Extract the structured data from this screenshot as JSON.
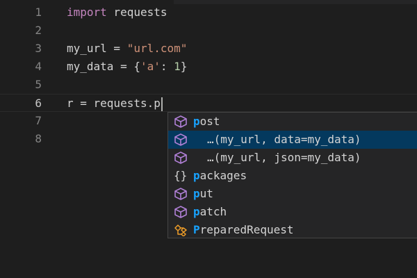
{
  "editor": {
    "lines": [
      {
        "number": "1",
        "tokens": [
          {
            "t": "import",
            "c": "kw"
          },
          {
            "t": " requests",
            "c": "txt"
          }
        ]
      },
      {
        "number": "2",
        "tokens": []
      },
      {
        "number": "3",
        "tokens": [
          {
            "t": "my_url",
            "c": "txt"
          },
          {
            "t": " = ",
            "c": "txt"
          },
          {
            "t": "\"url.com\"",
            "c": "str"
          }
        ]
      },
      {
        "number": "4",
        "tokens": [
          {
            "t": "my_data",
            "c": "txt"
          },
          {
            "t": " = {",
            "c": "txt"
          },
          {
            "t": "'a'",
            "c": "str"
          },
          {
            "t": ": ",
            "c": "txt"
          },
          {
            "t": "1",
            "c": "num"
          },
          {
            "t": "}",
            "c": "txt"
          }
        ]
      },
      {
        "number": "5",
        "tokens": []
      },
      {
        "number": "6",
        "tokens": [
          {
            "t": "r = requests.p",
            "c": "txt"
          }
        ],
        "current": true
      },
      {
        "number": "7",
        "tokens": []
      },
      {
        "number": "8",
        "tokens": []
      }
    ]
  },
  "suggestions": [
    {
      "icon": "cube-icon",
      "match": "p",
      "rest": "ost",
      "indent": false,
      "selected": false
    },
    {
      "icon": "cube-icon",
      "match": "",
      "rest": "…(my_url, data=my_data)",
      "indent": true,
      "selected": true
    },
    {
      "icon": "cube-icon",
      "match": "",
      "rest": "…(my_url, json=my_data)",
      "indent": true,
      "selected": false
    },
    {
      "icon": "braces-icon",
      "match": "p",
      "rest": "ackages",
      "indent": false,
      "selected": false
    },
    {
      "icon": "cube-icon",
      "match": "p",
      "rest": "ut",
      "indent": false,
      "selected": false
    },
    {
      "icon": "cube-icon",
      "match": "p",
      "rest": "atch",
      "indent": false,
      "selected": false
    },
    {
      "icon": "class-icon",
      "match": "P",
      "rest": "reparedRequest",
      "indent": false,
      "selected": false
    }
  ],
  "colors": {
    "background": "#1e1e1e",
    "suggest_bg": "#252526",
    "selected_bg": "#04395e",
    "match_highlight": "#18a3ff",
    "keyword": "#c586c0",
    "string": "#ce9178",
    "number": "#b5cea8",
    "cube_icon": "#b180d7",
    "class_icon": "#ee9d28"
  }
}
